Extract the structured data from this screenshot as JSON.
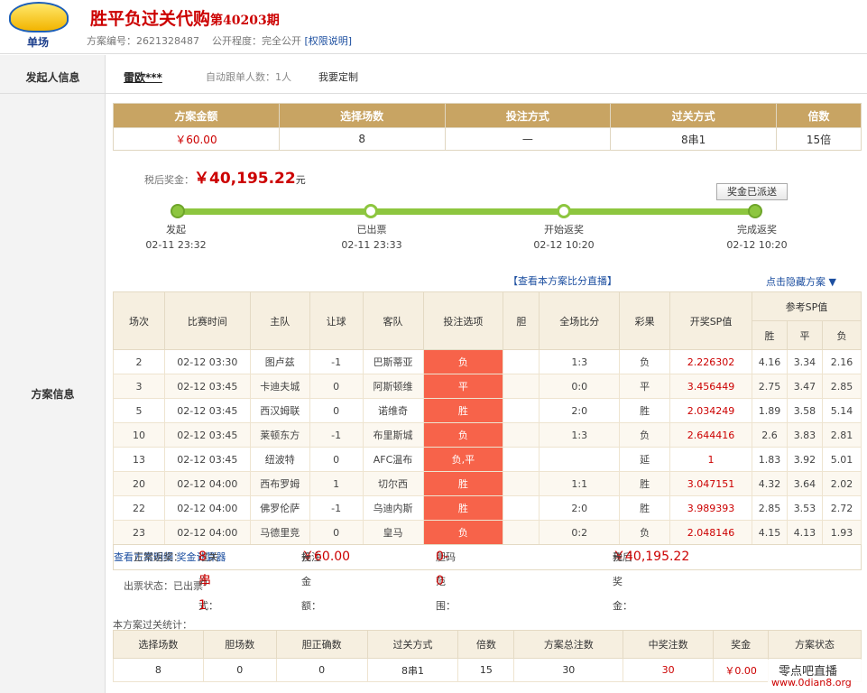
{
  "header": {
    "logo_text": "单场",
    "title": "胜平负过关代购",
    "issue": "第40203期",
    "plan_no_label": "方案编号：",
    "plan_no": "2621328487",
    "public_label": "公开程度：",
    "public_value": "完全公开",
    "perm_link": "[权限说明]"
  },
  "initiator": {
    "section_label": "发起人信息",
    "user": "雷欧***",
    "follow_text": "自动跟单人数：1人",
    "custom_link": "我要定制"
  },
  "plan_section_label": "方案信息",
  "overview": {
    "headers": [
      "方案金额",
      "选择场数",
      "投注方式",
      "过关方式",
      "倍数"
    ],
    "values": [
      "￥60.00",
      "8",
      "—",
      "8串1",
      "15倍"
    ]
  },
  "prize": {
    "label": "税后奖金：",
    "value": "￥40,195.22",
    "unit": "元",
    "sent_button": "奖金已派送"
  },
  "progress": {
    "steps": [
      {
        "label": "发起",
        "time": "02-11 23:32"
      },
      {
        "label": "已出票",
        "time": "02-11 23:33"
      },
      {
        "label": "开始返奖",
        "time": "02-12 10:20"
      },
      {
        "label": "完成返奖",
        "time": "02-12 10:20"
      }
    ]
  },
  "links": {
    "live": "【查看本方案比分直播】",
    "hide": "点击隐藏方案 ▼"
  },
  "matches": {
    "headers": [
      "场次",
      "比赛时间",
      "主队",
      "让球",
      "客队",
      "投注选项",
      "胆",
      "全场比分",
      "彩果",
      "开奖SP值"
    ],
    "sp_group": "参考SP值",
    "sp_headers": [
      "胜",
      "平",
      "负"
    ],
    "rows": [
      {
        "no": "2",
        "time": "02-12 03:30",
        "home": "图卢兹",
        "hcp": "-1",
        "away": "巴斯蒂亚",
        "pick": "负",
        "dan": "",
        "score": "1:3",
        "result": "负",
        "sp": "2.226302",
        "w": "4.16",
        "d": "3.34",
        "l": "2.16"
      },
      {
        "no": "3",
        "time": "02-12 03:45",
        "home": "卡迪夫城",
        "hcp": "0",
        "away": "阿斯顿维",
        "pick": "平",
        "dan": "",
        "score": "0:0",
        "result": "平",
        "sp": "3.456449",
        "w": "2.75",
        "d": "3.47",
        "l": "2.85"
      },
      {
        "no": "5",
        "time": "02-12 03:45",
        "home": "西汉姆联",
        "hcp": "0",
        "away": "诺维奇",
        "pick": "胜",
        "dan": "",
        "score": "2:0",
        "result": "胜",
        "sp": "2.034249",
        "w": "1.89",
        "d": "3.58",
        "l": "5.14"
      },
      {
        "no": "10",
        "time": "02-12 03:45",
        "home": "莱顿东方",
        "hcp": "-1",
        "away": "布里斯城",
        "pick": "负",
        "dan": "",
        "score": "1:3",
        "result": "负",
        "sp": "2.644416",
        "w": "2.6",
        "d": "3.83",
        "l": "2.81"
      },
      {
        "no": "13",
        "time": "02-12 03:45",
        "home": "纽波特",
        "hcp": "0",
        "away": "AFC温布",
        "pick": "负,平",
        "dan": "",
        "score": "",
        "result": "延",
        "sp": "1",
        "w": "1.83",
        "d": "3.92",
        "l": "5.01"
      },
      {
        "no": "20",
        "time": "02-12 04:00",
        "home": "西布罗姆",
        "hcp": "1",
        "away": "切尔西",
        "pick": "胜",
        "dan": "",
        "score": "1:1",
        "result": "胜",
        "sp": "3.047151",
        "w": "4.32",
        "d": "3.64",
        "l": "2.02"
      },
      {
        "no": "22",
        "time": "02-12 04:00",
        "home": "佛罗伦萨",
        "hcp": "-1",
        "away": "乌迪内斯",
        "pick": "胜",
        "dan": "",
        "score": "2:0",
        "result": "胜",
        "sp": "3.989393",
        "w": "2.85",
        "d": "3.53",
        "l": "2.72"
      },
      {
        "no": "23",
        "time": "02-12 04:00",
        "home": "马德里竞",
        "hcp": "0",
        "away": "皇马",
        "pick": "负",
        "dan": "",
        "score": "0:2",
        "result": "负",
        "sp": "2.048146",
        "w": "4.15",
        "d": "4.13",
        "l": "1.93"
      }
    ]
  },
  "summary": {
    "normal_label": "正常返奖：",
    "pass_label": "过关方式：",
    "pass_value": "8串1",
    "bet_label": "投注金额：",
    "bet_value": "￥60.00",
    "bet_unit": "元",
    "dan_label": "胆码范围：",
    "dan_value": "0-0",
    "detail_link": "查看方案明细",
    "prize_label": "税后奖金：",
    "prize_value": "￥40,195.22",
    "prize_unit": "元",
    "calc_link": "奖金计算器"
  },
  "ticket_status": "出票状态：已出票",
  "stats": {
    "title": "本方案过关统计：",
    "headers": [
      "选择场数",
      "胆场数",
      "胆正确数",
      "过关方式",
      "倍数",
      "方案总注数",
      "中奖注数",
      "奖金",
      "方案状态"
    ],
    "values": [
      "8",
      "0",
      "0",
      "8串1",
      "15",
      "30",
      "30",
      "￥0.00",
      ""
    ]
  },
  "watermark": {
    "name": "零点吧直播",
    "url": "www.0dian8.org"
  },
  "colors": {
    "title_red": "#cc0000",
    "gold_header": "#c8a463",
    "pick_red": "#f7634a",
    "progress_green": "#8dc63f",
    "link_blue": "#1d4fa0"
  }
}
